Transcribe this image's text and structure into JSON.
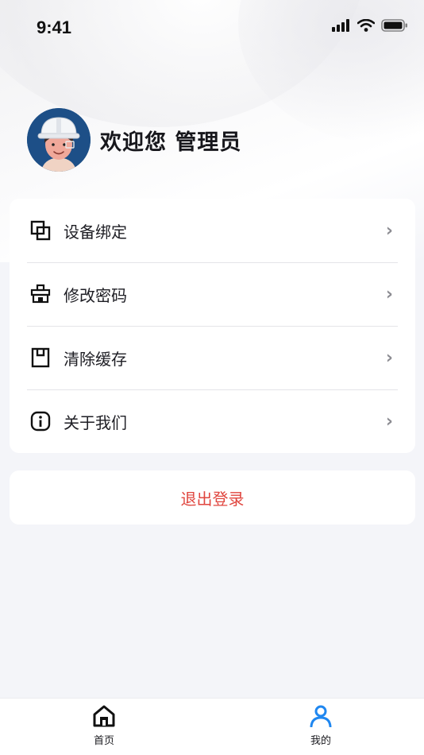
{
  "status_bar": {
    "time": "9:41",
    "icons": [
      "signal-icon",
      "wifi-icon",
      "battery-icon"
    ]
  },
  "profile": {
    "welcome": "欢迎您 管理员",
    "avatar": "worker-helmet-avatar"
  },
  "menu": {
    "items": [
      {
        "label": "设备绑定",
        "icon": "device-bind-icon"
      },
      {
        "label": "修改密码",
        "icon": "password-icon"
      },
      {
        "label": "清除缓存",
        "icon": "clear-cache-icon"
      },
      {
        "label": "关于我们",
        "icon": "info-icon"
      }
    ],
    "chevron": "›"
  },
  "logout": {
    "label": "退出登录",
    "color": "#e0463f"
  },
  "tabbar": {
    "tabs": [
      {
        "label": "首页",
        "icon": "home-icon",
        "active": false
      },
      {
        "label": "我的",
        "icon": "user-icon",
        "active": true
      }
    ],
    "active_color": "#1f87f0"
  }
}
